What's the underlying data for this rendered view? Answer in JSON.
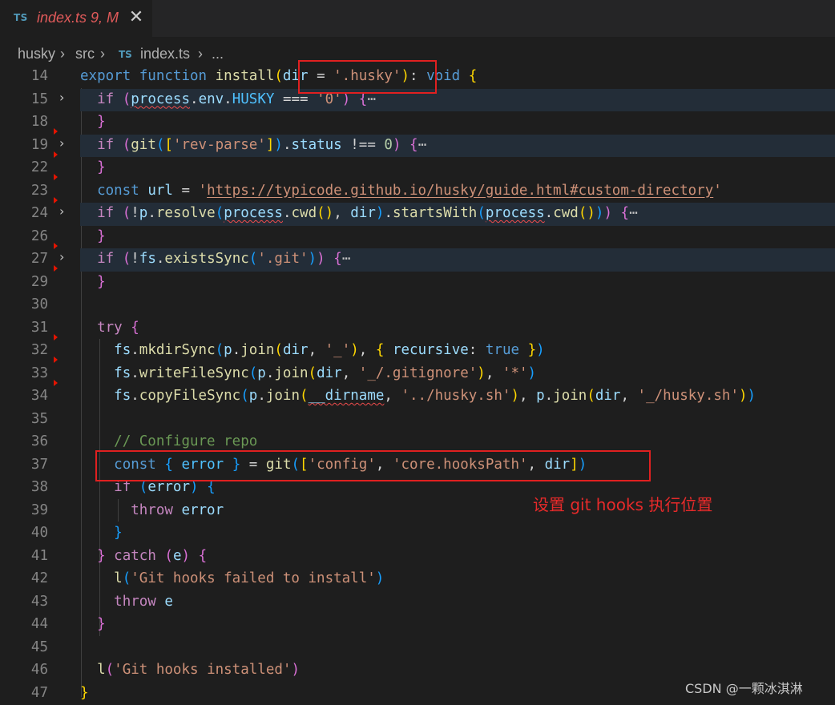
{
  "tab": {
    "lang_badge": "TS",
    "title": "index.ts 9, M",
    "close_glyph": "✕"
  },
  "breadcrumb": {
    "items": [
      "husky",
      "src",
      "index.ts",
      "..."
    ],
    "separator": "›",
    "file_icon": "TS"
  },
  "editor": {
    "line_numbers": [
      "14",
      "15",
      "18",
      "19",
      "22",
      "23",
      "24",
      "26",
      "27",
      "29",
      "30",
      "31",
      "32",
      "33",
      "34",
      "35",
      "36",
      "37",
      "38",
      "39",
      "40",
      "41",
      "42",
      "43",
      "44",
      "45",
      "46",
      "47"
    ],
    "fold_glyph": "›",
    "ellipsis": "⋯"
  },
  "annotation": "设置 git hooks 执行位置",
  "watermark": "CSDN @一颗冰淇淋",
  "colors": {
    "background": "#1e1e1e",
    "keyword": "#569cd6",
    "control": "#c586c0",
    "function": "#dcdcaa",
    "variable": "#9cdcfe",
    "string": "#ce9178",
    "number": "#b5cea8",
    "comment": "#6a9955",
    "annotation_red": "#e02020"
  }
}
